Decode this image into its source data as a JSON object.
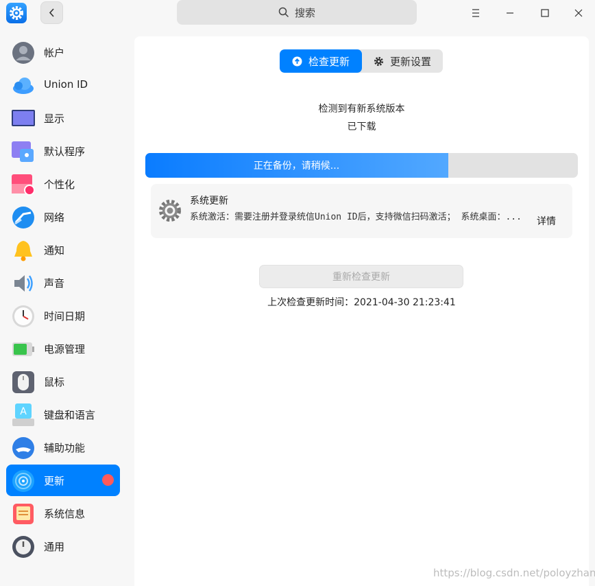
{
  "search": {
    "label": "搜索"
  },
  "sidebar": {
    "items": [
      {
        "label": "帐户",
        "icon": "account-icon"
      },
      {
        "label": "Union ID",
        "icon": "cloud-icon"
      },
      {
        "label": "显示",
        "icon": "display-icon"
      },
      {
        "label": "默认程序",
        "icon": "default-apps-icon"
      },
      {
        "label": "个性化",
        "icon": "personalization-icon"
      },
      {
        "label": "网络",
        "icon": "network-icon"
      },
      {
        "label": "通知",
        "icon": "bell-icon"
      },
      {
        "label": "声音",
        "icon": "speaker-icon"
      },
      {
        "label": "时间日期",
        "icon": "clock-icon"
      },
      {
        "label": "电源管理",
        "icon": "battery-icon"
      },
      {
        "label": "鼠标",
        "icon": "mouse-icon"
      },
      {
        "label": "键盘和语言",
        "icon": "keyboard-icon"
      },
      {
        "label": "辅助功能",
        "icon": "accessibility-icon"
      },
      {
        "label": "更新",
        "icon": "update-icon",
        "active": true,
        "badge": true
      },
      {
        "label": "系统信息",
        "icon": "system-info-icon"
      },
      {
        "label": "通用",
        "icon": "general-icon"
      }
    ]
  },
  "main": {
    "tabs": [
      {
        "label": "检查更新",
        "active": true
      },
      {
        "label": "更新设置",
        "active": false
      }
    ],
    "status": "检测到有新系统版本",
    "substatus": "已下载",
    "progress": {
      "label": "正在备份，请稍候...",
      "fraction": 0.7
    },
    "update_item": {
      "title": "系统更新",
      "description": "系统激活：需要注册并登录统信Union ID后，支持微信扫码激活；  系统桌面：...",
      "detail_label": "详情"
    },
    "recheck_label": "重新检查更新",
    "last_check": "上次检查更新时间：2021-04-30 21:23:41"
  },
  "watermark": "https://blog.csdn.net/poloyzhang",
  "colors": {
    "accent": "#0081ff",
    "badge": "#ff5a5a"
  }
}
